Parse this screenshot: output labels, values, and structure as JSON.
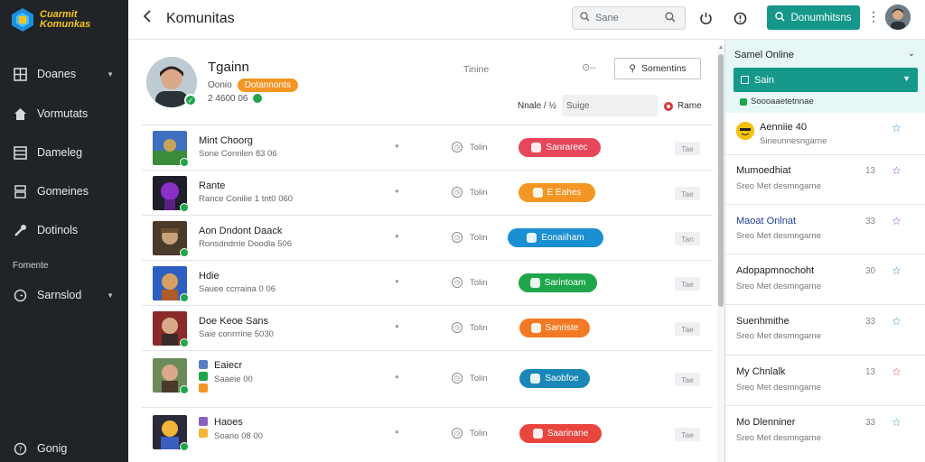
{
  "brand": {
    "line1": "Cuarmit",
    "line2": "Komunkas"
  },
  "sidebar": {
    "items": [
      {
        "label": "Doanes",
        "icon": "grid-icon",
        "caret": true
      },
      {
        "label": "Vormutats",
        "icon": "home-icon",
        "caret": false
      },
      {
        "label": "Dameleg",
        "icon": "layout-icon",
        "caret": false
      },
      {
        "label": "Gomeines",
        "icon": "users-icon",
        "caret": false
      },
      {
        "label": "Dotinols",
        "icon": "wrench-icon",
        "caret": false
      }
    ],
    "section_label": "Fomente",
    "settings": {
      "label": "Sarnslod",
      "icon": "gear-icon"
    },
    "help": {
      "label": "Gonig",
      "icon": "question-icon"
    }
  },
  "topbar": {
    "back": "<",
    "title": "Komunitas",
    "search_placeholder": "Sane",
    "primary_button": "Donumhitsns"
  },
  "profile": {
    "name": "Tgainn",
    "sub_text": "Oonio",
    "tag": "Dotannonts",
    "count": "2 4600 06"
  },
  "controls": {
    "column_label": "Tinine",
    "outline_button": "Somentins",
    "filter_label": "Nnale / ½",
    "filter_value": "Suige",
    "filter_right": "Rame"
  },
  "rows": [
    {
      "name": "Mint Choorg",
      "meta": "Sone Conrilen 83 06",
      "status": "Tolin",
      "pill": "Sanrareec",
      "pill_color": "#e8465b",
      "badge": "Tae"
    },
    {
      "name": "Rante",
      "meta": "Rance Conilie 1 tnt0 060",
      "status": "Tolin",
      "pill": "E Eahes",
      "pill_color": "#f39623",
      "badge": "Tae"
    },
    {
      "name": "Aon Dndont Daack",
      "meta": "Ronsdndrrie Doodla 506",
      "status": "Tolin",
      "pill": "Eonaiiham",
      "pill_color": "#1a8fd1",
      "badge": "Tan"
    },
    {
      "name": "Hdie",
      "meta": "Sauee ccrraina 0 06",
      "status": "Tolin",
      "pill": "Sarintoam",
      "pill_color": "#1fa64a",
      "badge": "Tae"
    },
    {
      "name": "Doe Keoe Sans",
      "meta": "Saie conrrrine 5030",
      "status": "Tolin",
      "pill": "Sanriste",
      "pill_color": "#f37a24",
      "badge": "Tae"
    },
    {
      "name": "Eaiecr",
      "meta": "Saaeie 00",
      "status": "Tolin",
      "pill": "Saobfoe",
      "pill_color": "#1a87b8",
      "badge": "Tae"
    },
    {
      "name": "Haoes",
      "meta": "Soano 08 00",
      "status": "Tolin",
      "pill": "Saarinane",
      "pill_color": "#e8453f",
      "badge": "Tae"
    }
  ],
  "right_panel": {
    "title": "Samel Online",
    "select_label": "Sain",
    "sub_label": "Soooaaetetnnae",
    "items": [
      {
        "name": "Aenniie 40",
        "sub": "Sineunnesngarne",
        "num": "",
        "star_color": "#1a87d1"
      },
      {
        "name": "Mumoedhiat",
        "sub": "Sreo Met desmngarne",
        "num": "13",
        "star_color": "#8d3fbf"
      },
      {
        "name": "Maoat Onlnat",
        "sub": "Sreo Met desmngarne",
        "num": "33",
        "star_color": "#8d3fbf"
      },
      {
        "name": "Adopapmnochoht",
        "sub": "Sreo Met desmngarne",
        "num": "30",
        "star_color": "#1a87d1"
      },
      {
        "name": "Suenhmithe",
        "sub": "Sreo Met desmngarne",
        "num": "33",
        "star_color": "#1a87d1"
      },
      {
        "name": "My Chnlalk",
        "sub": "Sreo Met desmngarne",
        "num": "13",
        "star_color": "#e04545"
      },
      {
        "name": "Mo Dlenniner",
        "sub": "Sreo Met desmngarne",
        "num": "33",
        "star_color": "#1fa6a0"
      }
    ]
  },
  "colors": {
    "accent": "#15978a",
    "sidebar_bg": "#202327",
    "online": "#1fa64a"
  }
}
